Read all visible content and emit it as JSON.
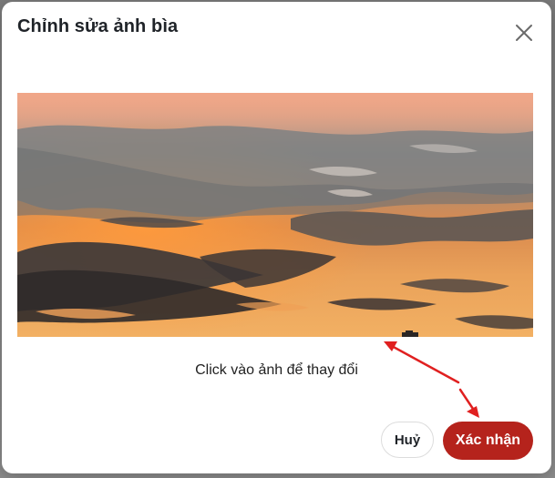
{
  "dialog": {
    "title": "Chỉnh sửa ảnh bìa",
    "close_icon": "close-icon",
    "hint": "Click vào ảnh để thay đổi",
    "cancel_label": "Huỷ",
    "confirm_label": "Xác nhận"
  },
  "colors": {
    "confirm_button": "#b5231c",
    "annotation_arrow": "#e02020"
  }
}
